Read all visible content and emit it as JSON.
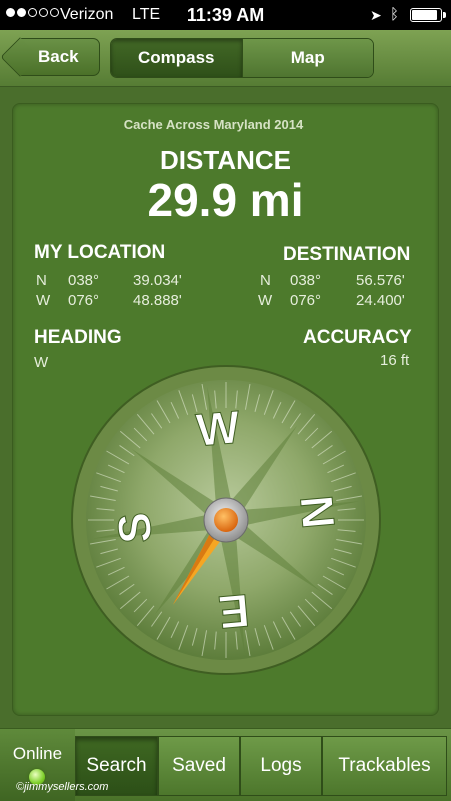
{
  "status_bar": {
    "carrier": "Verizon",
    "network": "LTE",
    "time": "11:39 AM",
    "signal_bars": 2,
    "battery_level": 0.9
  },
  "nav": {
    "back_label": "Back",
    "segments": [
      "Compass",
      "Map"
    ],
    "active_segment": "Compass"
  },
  "cache": {
    "name": "Cache Across Maryland 2014"
  },
  "distance": {
    "label": "DISTANCE",
    "value": "29.9 mi"
  },
  "my_location": {
    "label": "MY LOCATION",
    "lat": {
      "hemi": "N",
      "deg": "038°",
      "min": "39.034'"
    },
    "lon": {
      "hemi": "W",
      "deg": "076°",
      "min": "48.888'"
    }
  },
  "destination": {
    "label": "DESTINATION",
    "lat": {
      "hemi": "N",
      "deg": "038°",
      "min": "56.576'"
    },
    "lon": {
      "hemi": "W",
      "deg": "076°",
      "min": "24.400'"
    }
  },
  "heading": {
    "label": "HEADING",
    "value": "W"
  },
  "accuracy": {
    "label": "ACCURACY",
    "value": "16 ft"
  },
  "compass": {
    "letters": {
      "N": "N",
      "E": "E",
      "S": "S",
      "W": "W"
    },
    "needle_color": "#f5a623",
    "accent": "#e8791c"
  },
  "tab_bar": {
    "online_label": "Online",
    "online_status_color": "#7ecf2a",
    "tabs": [
      "Search",
      "Saved",
      "Logs",
      "Trackables"
    ],
    "active_tab": "Search"
  },
  "watermark": "©jimmysellers.com"
}
